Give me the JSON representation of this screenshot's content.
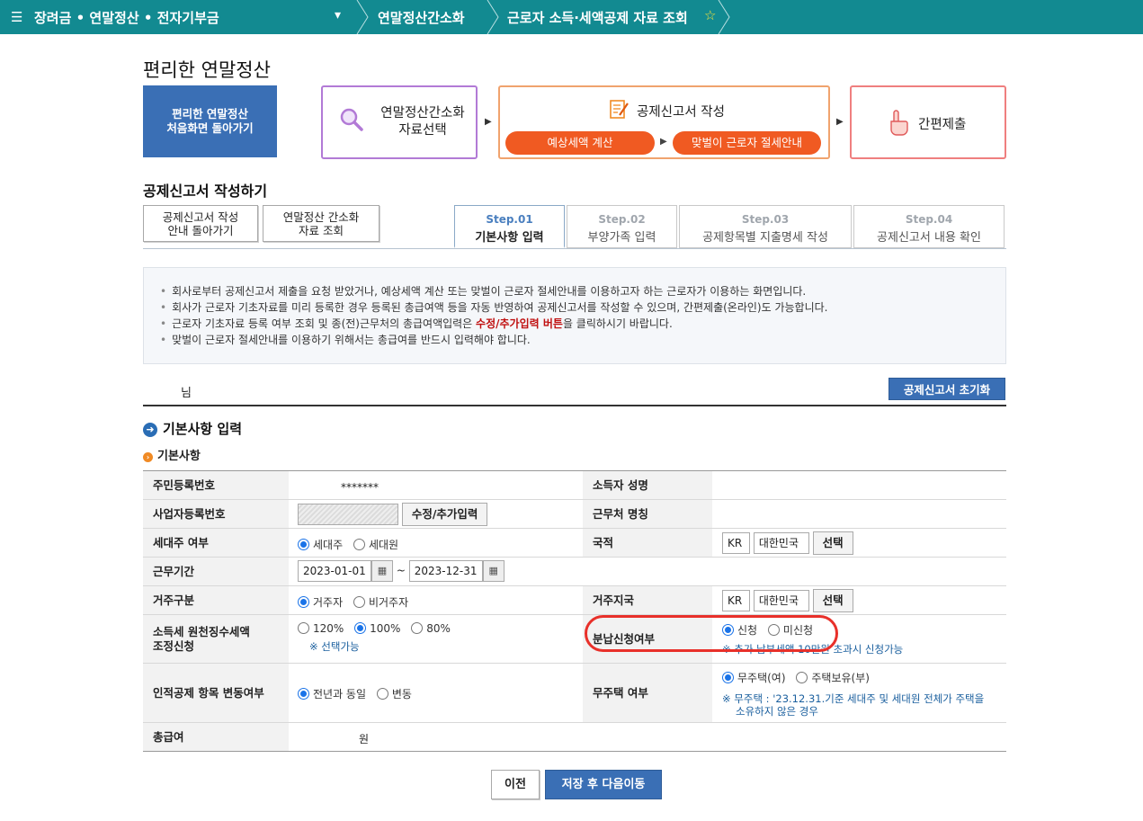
{
  "topbar": {
    "menu": "장려금 • 연말정산 • 전자기부금",
    "crumb1": "연말정산간소화",
    "crumb2": "근로자 소득·세액공제 자료 조회"
  },
  "page_title": "편리한 연말정산",
  "process": {
    "home_line1": "편리한 연말정산",
    "home_line2": "처음화면 돌아가기",
    "step1_line1": "연말정산간소화",
    "step1_line2": "자료선택",
    "step2": "공제신고서 작성",
    "step2_sub1": "예상세액 계산",
    "step2_sub2": "맞벌이 근로자 절세안내",
    "step3": "간편제출"
  },
  "section_title": "공제신고서 작성하기",
  "buttons": {
    "guide_line1": "공제신고서 작성",
    "guide_line2": "안내 돌아가기",
    "query_line1": "연말정산 간소화",
    "query_line2": "자료 조회",
    "reset": "공제신고서 초기화",
    "prev": "이전",
    "next": "저장 후 다음이동"
  },
  "tabs": [
    {
      "step": "Step.01",
      "name": "기본사항 입력"
    },
    {
      "step": "Step.02",
      "name": "부양가족 입력"
    },
    {
      "step": "Step.03",
      "name": "공제항목별 지출명세 작성"
    },
    {
      "step": "Step.04",
      "name": "공제신고서 내용 확인"
    }
  ],
  "notice": {
    "line1": "회사로부터 공제신고서 제출을 요청 받았거나, 예상세액 계산 또는 맞벌이 근로자 절세안내를 이용하고자 하는 근로자가 이용하는 화면입니다.",
    "line2": "회사가 근로자 기초자료를 미리 등록한 경우 등록된 총급여액 등을 자동 반영하여 공제신고서를 작성할 수 있으며, 간편제출(온라인)도 가능합니다.",
    "line3_pre": "근로자 기초자료 등록 여부 조회 및 종(전)근무처의 총급여액입력은 ",
    "line3_hl": "수정/추가입력 버튼",
    "line3_post": "을 클릭하시기 바랍니다.",
    "line4": "맞벌이 근로자 절세안내를 이용하기 위해서는 총급여를 반드시 입력해야 합니다."
  },
  "username_suffix": "님",
  "basic": {
    "header": "기본사항 입력",
    "subheader": "기본사항",
    "labels": {
      "rrn": "주민등록번호",
      "name": "소득자 성명",
      "bizno": "사업자등록번호",
      "company": "근무처 명칭",
      "household": "세대주 여부",
      "nationality": "국적",
      "period": "근무기간",
      "residence": "거주구분",
      "country": "거주지국",
      "withholding_line1": "소득세 원천징수세액",
      "withholding_line2": "조정신청",
      "installment": "분납신청여부",
      "personal": "인적공제 항목 변동여부",
      "nohouse": "무주택 여부",
      "salary": "총급여"
    },
    "rrn_value": "*******",
    "edit_button": "수정/추가입력",
    "household_opts": [
      "세대주",
      "세대원"
    ],
    "nation_code": "KR",
    "nation_name": "대한민국",
    "select_button": "선택",
    "period_from": "2023-01-01",
    "period_tilde": "~",
    "period_to": "2023-12-31",
    "residence_opts": [
      "거주자",
      "비거주자"
    ],
    "withholding_opts": [
      "120%",
      "100%",
      "80%"
    ],
    "withholding_note": "※ 선택가능",
    "installment_opts": [
      "신청",
      "미신청"
    ],
    "installment_note": "※ 추가 납부세액 10만원 초과시 신청가능",
    "personal_opts": [
      "전년과 동일",
      "변동"
    ],
    "nohouse_opts": [
      "무주택(여)",
      "주택보유(부)"
    ],
    "nohouse_note_line1": "※ 무주택 : '23.12.31.기준 세대주 및 세대원 전체가 주택을",
    "nohouse_note_line2": "소유하지 않은 경우",
    "salary_unit": "원"
  },
  "colors": {
    "topbar": "#128a91",
    "primary_button": "#3a6fb5",
    "orange": "#f05a22",
    "highlight_ring": "#e8302a"
  }
}
